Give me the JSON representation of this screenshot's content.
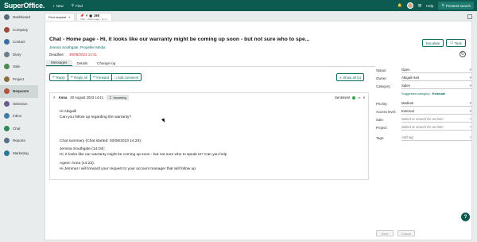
{
  "topbar": {
    "logo": "SuperOffice.",
    "new_label": "New",
    "find_label": "Find",
    "help_label": "Help",
    "presearch_label": "Prestest search"
  },
  "sidebar": {
    "items": [
      {
        "label": "Dashboard",
        "color": "#5b6b78"
      },
      {
        "label": "Company",
        "color": "#9c4a3a"
      },
      {
        "label": "Contact",
        "color": "#3b6ea5"
      },
      {
        "label": "Diary",
        "color": "#6b7c8a"
      },
      {
        "label": "Sale",
        "color": "#4c8a4f"
      },
      {
        "label": "Project",
        "color": "#8a6d3b"
      },
      {
        "label": "Requests",
        "color": "#b5523c"
      },
      {
        "label": "Selection",
        "color": "#6b5b95"
      },
      {
        "label": "Inbox",
        "color": "#3b7ea5"
      },
      {
        "label": "Chat",
        "color": "#2e8b57"
      },
      {
        "label": "Reports",
        "color": "#5a6f8a"
      },
      {
        "label": "Marketing",
        "color": "#2a7a9a"
      }
    ]
  },
  "tabs": {
    "find_request": "Find request",
    "ticket_id": "260",
    "ticket_sub": "Chat - Home page - Hi, it..."
  },
  "header": {
    "title": "Chat - Home page - Hi, it looks like our warranty might be coming up soon - but not sure who to spe...",
    "contact": "Jemma Southgate, Propeller Media",
    "deadline_label": "Deadline:",
    "deadline_value": "30/08/2023 14:41",
    "escalate_label": "Escalate",
    "task_label": "Task"
  },
  "subtabs": [
    "Messages",
    "Details",
    "Change log"
  ],
  "actions": {
    "reply": "Reply",
    "reply_all": "Reply all",
    "forward": "Forward",
    "add_comment": "Add comment",
    "show_all": "Show all (1)"
  },
  "message": {
    "author": "Anna",
    "date": "30 August 2023 14:41",
    "direction": "Incoming",
    "sentiment_label": "Sentiment",
    "line1": "Hi Abigail!",
    "line2": "Can you follow up regarding the warranty?",
    "summary": "Chat summary (Chat started: 30/08/2023 14:20):",
    "s1": "Jemma Southgate (14:18):",
    "s2": "Hi, it looks like our warranty might be coming up soon - but not sure who to speak to? Can you help",
    "s3": "Agent: Anna (14:23):",
    "s4": "Hi Jemma! I will forward your request to your account manager that will follow up."
  },
  "fields": {
    "status_label": "Status:",
    "status_value": "Open",
    "owner_label": "Owner:",
    "owner_value": "Abigail Hart",
    "category_label": "Category:",
    "category_value": "Sales",
    "suggested_label": "Suggested category:",
    "suggested_value": "Estimate",
    "priority_label": "Priority:",
    "priority_value": "Medium",
    "access_label": "Access level:",
    "access_value": "External",
    "sale_label": "Sale:",
    "sale_placeholder": "Select or search for an item",
    "project_label": "Project:",
    "project_placeholder": "Select or search for an item",
    "tags_label": "Tags:",
    "tags_placeholder": "Add tag"
  },
  "footer": {
    "save": "Save",
    "cancel": "Cancel"
  },
  "colors": {
    "brand": "#0c5a50",
    "accent": "#0b6e63",
    "deadline": "#c0272d"
  }
}
